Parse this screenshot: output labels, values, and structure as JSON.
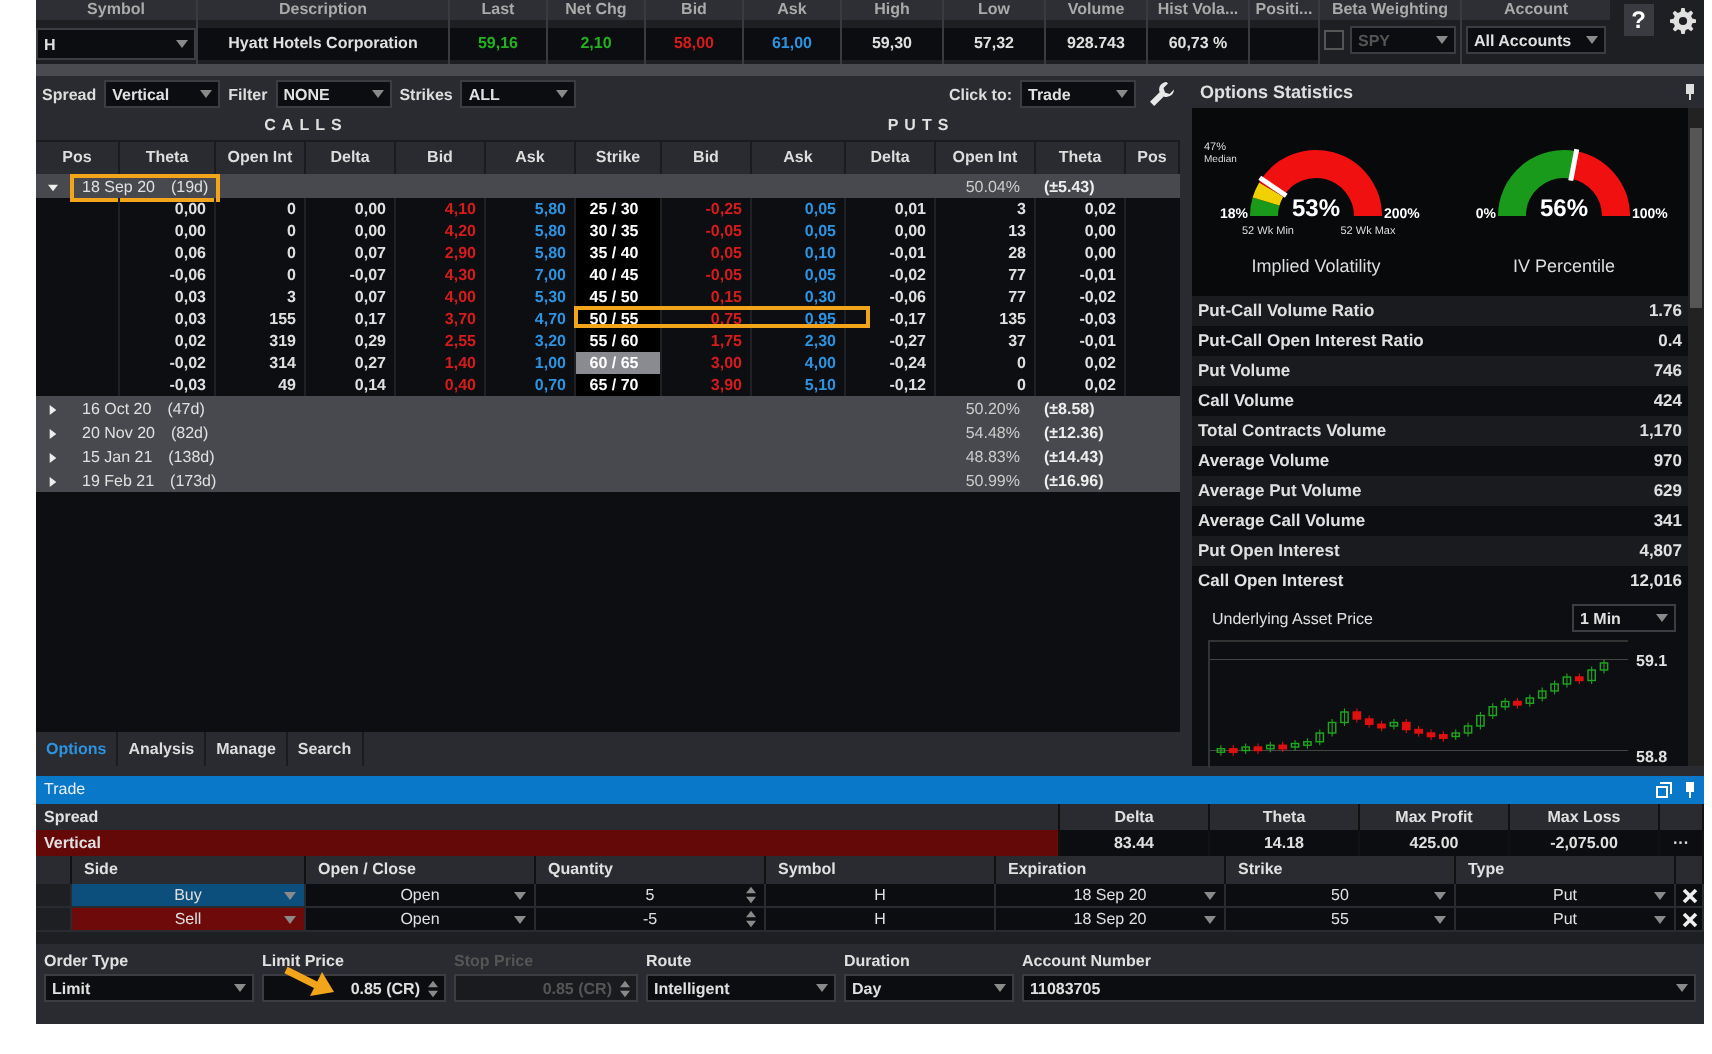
{
  "quote": {
    "symbol_label": "Symbol",
    "symbol": "H",
    "columns": [
      {
        "label": "Description",
        "value": "Hyatt Hotels Corporation",
        "color": "#e0e0e0"
      },
      {
        "label": "Last",
        "value": "59,16",
        "color": "#22b322"
      },
      {
        "label": "Net Chg",
        "value": "2,10",
        "color": "#22b322"
      },
      {
        "label": "Bid",
        "value": "58,00",
        "color": "#d41c1c"
      },
      {
        "label": "Ask",
        "value": "61,00",
        "color": "#2d93e0"
      },
      {
        "label": "High",
        "value": "59,30",
        "color": "#e0e0e0"
      },
      {
        "label": "Low",
        "value": "57,32",
        "color": "#e0e0e0"
      },
      {
        "label": "Volume",
        "value": "928.743",
        "color": "#e0e0e0"
      },
      {
        "label": "Hist Vola...",
        "value": "60,73 %",
        "color": "#e0e0e0"
      },
      {
        "label": "Positi..."
      }
    ],
    "beta_weighting": {
      "label": "Beta Weighting",
      "checked": false,
      "symbol": "SPY"
    },
    "account": {
      "label": "Account",
      "value": "All Accounts"
    },
    "help": "?"
  },
  "chain": {
    "toolbar": {
      "spread_label": "Spread",
      "spread": "Vertical",
      "filter_label": "Filter",
      "filter": "NONE",
      "strikes_label": "Strikes",
      "strikes": "ALL",
      "click_label": "Click to:",
      "click": "Trade"
    },
    "calls_title": "CALLS",
    "puts_title": "PUTS",
    "columns": [
      "Pos",
      "Theta",
      "Open Int",
      "Delta",
      "Bid",
      "Ask",
      "Strike",
      "Bid",
      "Ask",
      "Delta",
      "Open Int",
      "Theta",
      "Pos"
    ],
    "expirations": [
      {
        "date": "18 Sep 20",
        "days": "(19d)",
        "iv": "50.04%",
        "move": "(±5.43)",
        "expanded": true,
        "highlighted": true,
        "rows": [
          {
            "values": [
              "0,00",
              "0",
              "0,00",
              "4,10",
              "5,80",
              "25 / 30",
              "-0,25",
              "0,05",
              "0,01",
              "3",
              "0,02"
            ],
            "selected": false,
            "highlighted": false
          },
          {
            "values": [
              "0,00",
              "0",
              "0,00",
              "4,20",
              "5,80",
              "30 / 35",
              "-0,05",
              "0,05",
              "0,00",
              "13",
              "0,00"
            ],
            "selected": false,
            "highlighted": false
          },
          {
            "values": [
              "0,06",
              "0",
              "0,07",
              "2,90",
              "5,80",
              "35 / 40",
              "0,05",
              "0,10",
              "-0,01",
              "28",
              "0,00"
            ],
            "selected": false,
            "highlighted": false
          },
          {
            "values": [
              "-0,06",
              "0",
              "-0,07",
              "4,30",
              "7,00",
              "40 / 45",
              "-0,05",
              "0,05",
              "-0,02",
              "77",
              "-0,01"
            ],
            "selected": false,
            "highlighted": false
          },
          {
            "values": [
              "0,03",
              "3",
              "0,07",
              "4,00",
              "5,30",
              "45 / 50",
              "0,15",
              "0,30",
              "-0,06",
              "77",
              "-0,02"
            ],
            "selected": false,
            "highlighted": false
          },
          {
            "values": [
              "0,03",
              "155",
              "0,17",
              "3,70",
              "4,70",
              "50 / 55",
              "0,75",
              "0,95",
              "-0,17",
              "135",
              "-0,03"
            ],
            "selected": false,
            "highlighted": true
          },
          {
            "values": [
              "0,02",
              "319",
              "0,29",
              "2,55",
              "3,20",
              "55 / 60",
              "1,75",
              "2,30",
              "-0,27",
              "37",
              "-0,01"
            ],
            "selected": false,
            "highlighted": false
          },
          {
            "values": [
              "-0,02",
              "314",
              "0,27",
              "1,40",
              "1,00",
              "60 / 65",
              "3,00",
              "4,00",
              "-0,24",
              "0",
              "0,02"
            ],
            "selected": true,
            "highlighted": false
          },
          {
            "values": [
              "-0,03",
              "49",
              "0,14",
              "0,40",
              "0,70",
              "65 / 70",
              "3,90",
              "5,10",
              "-0,12",
              "0",
              "0,02"
            ],
            "selected": false,
            "highlighted": false
          }
        ]
      },
      {
        "date": "16 Oct 20",
        "days": "(47d)",
        "iv": "50.20%",
        "move": "(±8.58)",
        "expanded": false,
        "highlighted": false
      },
      {
        "date": "20 Nov 20",
        "days": "(82d)",
        "iv": "54.48%",
        "move": "(±12.36)",
        "expanded": false,
        "highlighted": false
      },
      {
        "date": "15 Jan 21",
        "days": "(138d)",
        "iv": "48.83%",
        "move": "(±14.43)",
        "expanded": false,
        "highlighted": false
      },
      {
        "date": "19 Feb 21",
        "days": "(173d)",
        "iv": "50.99%",
        "move": "(±16.96)",
        "expanded": false,
        "highlighted": false
      }
    ],
    "tabs": [
      {
        "label": "Options",
        "selected": true
      },
      {
        "label": "Analysis",
        "selected": false
      },
      {
        "label": "Manage",
        "selected": false
      },
      {
        "label": "Search",
        "selected": false
      }
    ]
  },
  "statistics": {
    "title": "Options Statistics",
    "gauges": [
      {
        "kind": "iv",
        "value": "53%",
        "min": "18%",
        "max": "200%",
        "min_caption": "52 Wk Min",
        "max_caption": "52 Wk Max",
        "median": "47%",
        "median_caption": "Median",
        "label": "Implied Volatility"
      },
      {
        "kind": "percentile",
        "value": "56%",
        "min": "0%",
        "max": "100%",
        "label": "IV Percentile"
      }
    ],
    "rows": [
      {
        "label": "Put-Call Volume Ratio",
        "value": "1.76"
      },
      {
        "label": "Put-Call Open Interest Ratio",
        "value": "0.4"
      },
      {
        "label": "Put Volume",
        "value": "746"
      },
      {
        "label": "Call Volume",
        "value": "424"
      },
      {
        "label": "Total Contracts Volume",
        "value": "1,170"
      },
      {
        "label": "Average Volume",
        "value": "970"
      },
      {
        "label": "Average Put Volume",
        "value": "629"
      },
      {
        "label": "Average Call Volume",
        "value": "341"
      },
      {
        "label": "Put Open Interest",
        "value": "4,807"
      },
      {
        "label": "Call Open Interest",
        "value": "12,016"
      }
    ],
    "price_chart": {
      "title": "Underlying Asset Price",
      "interval": "1 Min",
      "ticks": [
        "59.1",
        "58.8"
      ]
    }
  },
  "trade": {
    "title": "Trade",
    "summary_columns": [
      "Spread",
      "Delta",
      "Theta",
      "Max Profit",
      "Max Loss"
    ],
    "summary_values": [
      "Vertical",
      "83.44",
      "14.18",
      "425.00",
      "-2,075.00"
    ],
    "more": "···",
    "leg_columns": [
      "Side",
      "Open / Close",
      "Quantity",
      "Symbol",
      "Expiration",
      "Strike",
      "Type"
    ],
    "legs": [
      {
        "side": "Buy",
        "kind": "buy",
        "open_close": "Open",
        "quantity": "5",
        "symbol": "H",
        "expiration": "18 Sep 20",
        "strike": "50",
        "type": "Put"
      },
      {
        "side": "Sell",
        "kind": "sell",
        "open_close": "Open",
        "quantity": "-5",
        "symbol": "H",
        "expiration": "18 Sep 20",
        "strike": "55",
        "type": "Put"
      }
    ],
    "order": [
      {
        "label": "Order Type",
        "value": "Limit",
        "kind": "dropdown",
        "disabled": false,
        "pointed_at": false
      },
      {
        "label": "Limit Price",
        "value": "0.85 (CR)",
        "kind": "spinner",
        "disabled": false,
        "pointed_at": true
      },
      {
        "label": "Stop Price",
        "value": "0.85 (CR)",
        "kind": "spinner",
        "disabled": true,
        "pointed_at": false
      },
      {
        "label": "Route",
        "value": "Intelligent",
        "kind": "dropdown",
        "disabled": false,
        "pointed_at": false
      },
      {
        "label": "Duration",
        "value": "Day",
        "kind": "dropdown",
        "disabled": false,
        "pointed_at": false
      },
      {
        "label": "Account Number",
        "value": "11083705",
        "kind": "dropdown",
        "disabled": false,
        "pointed_at": false
      }
    ]
  }
}
